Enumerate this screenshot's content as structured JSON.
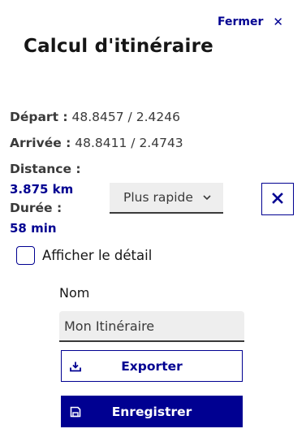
{
  "header": {
    "close_label": "Fermer",
    "close_icon": "close-icon",
    "title": "Calcul d'itinéraire"
  },
  "route": {
    "depart_label": "Départ :",
    "depart_value": "48.8457 / 2.4246",
    "arrivee_label": "Arrivée :",
    "arrivee_value": "48.8411 / 2.4743",
    "distance_label": "Distance :",
    "distance_value": "3.875 km",
    "duree_label": "Durée :",
    "duree_value": "58 min"
  },
  "mode_select": {
    "selected": "Plus rapide",
    "icon": "chevron-down-icon"
  },
  "clear_button": {
    "icon": "close-icon"
  },
  "detail_checkbox": {
    "label": "Afficher le détail",
    "checked": false
  },
  "save_form": {
    "name_label": "Nom",
    "name_value": "Mon Itinéraire",
    "export_label": "Exporter",
    "export_icon": "download-icon",
    "save_label": "Enregistrer",
    "save_icon": "save-icon"
  },
  "colors": {
    "accent": "#000091",
    "text": "#3a3a3a",
    "input_bg": "#eeeeee"
  }
}
